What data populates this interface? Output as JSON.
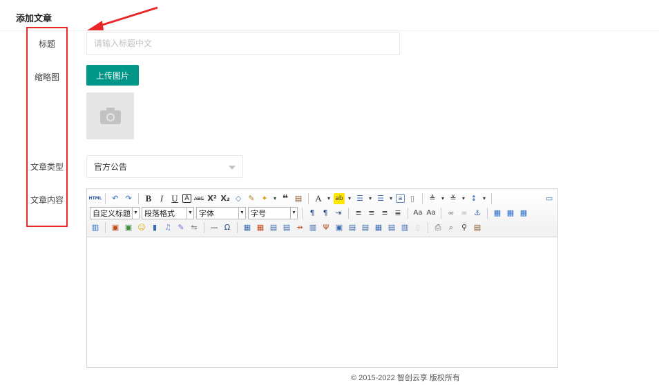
{
  "page": {
    "title": "添加文章"
  },
  "form": {
    "title_label": "标题",
    "title_placeholder": "请输入标题中文",
    "thumbnail_label": "缩略图",
    "upload_button": "上传图片",
    "type_label": "文章类型",
    "type_value": "官方公告",
    "content_label": "文章内容"
  },
  "editor": {
    "combos": {
      "custom_title": "自定义标题",
      "paragraph": "段落格式",
      "font": "字体",
      "size": "字号"
    },
    "row1_icons": [
      "html-icon",
      "undo-icon",
      "redo-icon",
      "bold-icon",
      "italic-icon",
      "underline-icon",
      "fontborder-icon",
      "strikethrough-icon",
      "superscript-icon",
      "subscript-icon",
      "removeformat-icon",
      "formatmatch-icon",
      "autotypeset-icon",
      "blockquote-icon",
      "pasteplain-icon",
      "forecolor-icon",
      "backcolor-icon",
      "insertorderedlist-icon",
      "insertunorderedlist-icon",
      "selectall-icon",
      "cleardoc-icon",
      "rowspacingtop-icon",
      "rowspacingbottom-icon",
      "lineheight-icon",
      "fullscreen-icon"
    ],
    "row1_glyphs": [
      "HTML",
      "↶",
      "↷",
      "B",
      "I",
      "U",
      "A",
      "ABC",
      "X²",
      "X₂",
      "⌫",
      "🖌",
      "✧",
      "❝",
      "📋",
      "A",
      "ab",
      "≡",
      "≡",
      "a",
      "▢",
      "≡",
      "≡",
      "≡",
      "🖥"
    ]
  },
  "footer": {
    "text": "© 2015-2022 智创云享 版权所有"
  },
  "colors": {
    "accent": "#009688",
    "highlight_box": "#e8282b"
  }
}
